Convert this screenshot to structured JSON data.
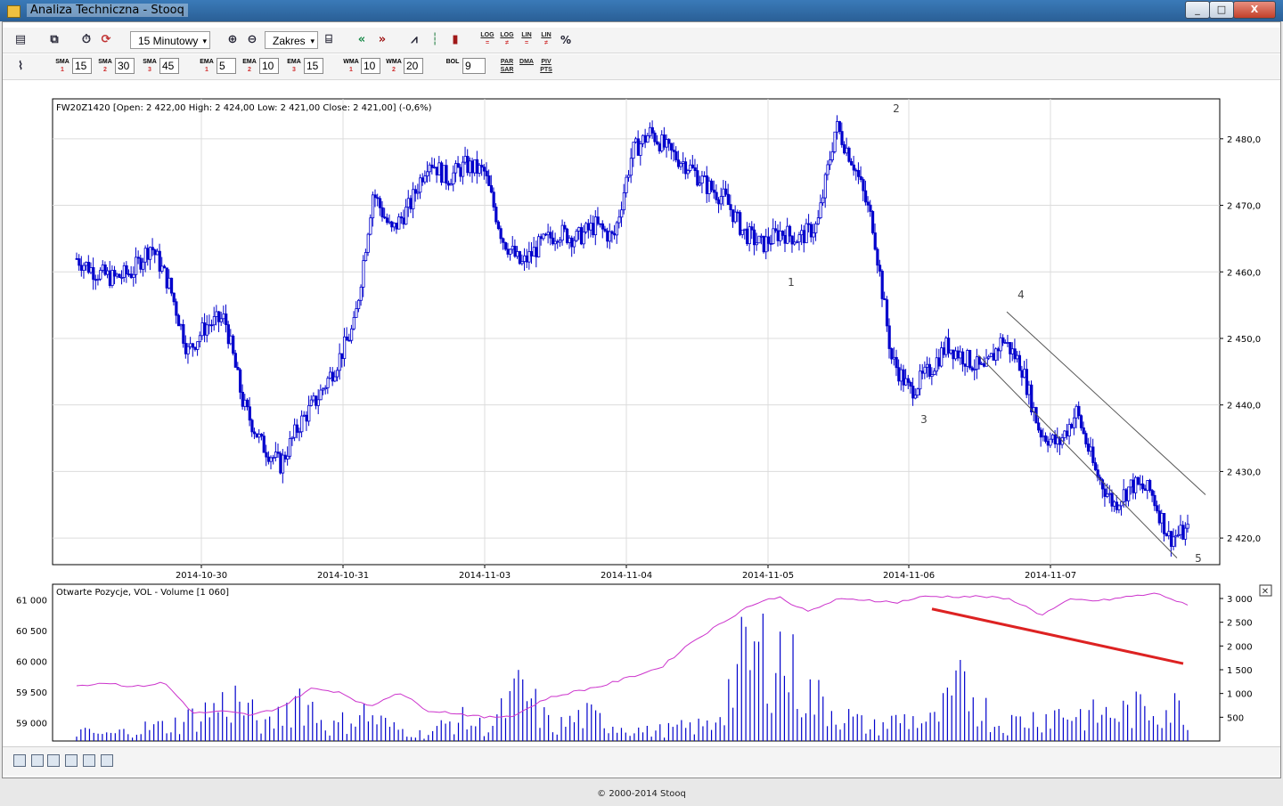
{
  "window": {
    "title": "Analiza Techniczna - Stooq",
    "minimize": "_",
    "maximize": "□",
    "close": "X"
  },
  "toolbar1": {
    "interval": "15 Minutowy",
    "range": "Zakres",
    "scales": [
      {
        "top": "LOG",
        "bottom": "="
      },
      {
        "top": "LOG",
        "bottom": "≠"
      },
      {
        "top": "LIN",
        "bottom": "="
      },
      {
        "top": "LIN",
        "bottom": "≠"
      }
    ],
    "percent": "%"
  },
  "toolbar2": {
    "indicators": [
      {
        "name": "SMA",
        "num": "1",
        "value": "15"
      },
      {
        "name": "SMA",
        "num": "2",
        "value": "30"
      },
      {
        "name": "SMA",
        "num": "3",
        "value": "45"
      },
      {
        "name": "EMA",
        "num": "1",
        "value": "5"
      },
      {
        "name": "EMA",
        "num": "2",
        "value": "10"
      },
      {
        "name": "EMA",
        "num": "3",
        "value": "15"
      },
      {
        "name": "WMA",
        "num": "1",
        "value": "10"
      },
      {
        "name": "WMA",
        "num": "2",
        "value": "20"
      },
      {
        "name": "BOL",
        "num": "",
        "value": "9"
      }
    ],
    "extra": [
      {
        "top": "PAR",
        "bottom": "SAR"
      },
      {
        "top": "DMA",
        "bottom": ""
      },
      {
        "top": "PIV",
        "bottom": "PTS"
      }
    ]
  },
  "price_panel": {
    "header": "FW20Z1420 [Open: 2 422,00  High: 2 424,00  Low: 2 421,00  Close: 2 421,00] (-0,6%)",
    "y_ticks": [
      "2 480,0",
      "2 470,0",
      "2 460,0",
      "2 450,0",
      "2 440,0",
      "2 430,0",
      "2 420,0"
    ],
    "x_ticks": [
      "2014-10-30",
      "2014-10-31",
      "2014-11-03",
      "2014-11-04",
      "2014-11-05",
      "2014-11-06",
      "2014-11-07"
    ],
    "wave_labels": [
      "2",
      "1",
      "4",
      "3",
      "5"
    ]
  },
  "volume_panel": {
    "header": "Otwarte Pozycje, VOL - Volume [1 060]",
    "left_ticks": [
      "61 000",
      "60 500",
      "60 000",
      "59 500",
      "59 000"
    ],
    "right_ticks": [
      "3 000",
      "2 500",
      "2 000",
      "1 500",
      "1 000",
      "500"
    ],
    "close": "✕"
  },
  "footer": {
    "copyright": "© 2000-2014 Stooq"
  },
  "colors": {
    "candle": "#0000cc",
    "open_interest": "#cc33cc",
    "trend": "#dd2222",
    "channel": "#444444"
  },
  "chart_data": [
    {
      "type": "candlestick",
      "instrument": "FW20Z1420",
      "interval": "15 min",
      "title": "FW20Z1420 [Open: 2 422,00  High: 2 424,00  Low: 2 421,00  Close: 2 421,00] (-0,6%)",
      "x": [
        "2014-10-30",
        "2014-10-31",
        "2014-11-03",
        "2014-11-04",
        "2014-11-05",
        "2014-11-06",
        "2014-11-07"
      ],
      "ylim": [
        2416,
        2486
      ],
      "approx_path": [
        {
          "t": "2014-10-29",
          "price": 2462
        },
        {
          "t": "2014-10-29",
          "price": 2460
        },
        {
          "t": "2014-10-29",
          "price": 2459
        },
        {
          "t": "2014-10-29",
          "price": 2460
        },
        {
          "t": "2014-10-29",
          "price": 2464
        },
        {
          "t": "2014-10-30",
          "price": 2458
        },
        {
          "t": "2014-10-30",
          "price": 2448
        },
        {
          "t": "2014-10-30",
          "price": 2452
        },
        {
          "t": "2014-10-30",
          "price": 2453
        },
        {
          "t": "2014-10-30",
          "price": 2440
        },
        {
          "t": "2014-10-30",
          "price": 2434
        },
        {
          "t": "2014-10-30",
          "price": 2431
        },
        {
          "t": "2014-10-30",
          "price": 2437
        },
        {
          "t": "2014-10-30",
          "price": 2441
        },
        {
          "t": "2014-10-30",
          "price": 2446
        },
        {
          "t": "2014-10-30",
          "price": 2452
        },
        {
          "t": "2014-10-31",
          "price": 2472
        },
        {
          "t": "2014-10-31",
          "price": 2466
        },
        {
          "t": "2014-10-31",
          "price": 2470
        },
        {
          "t": "2014-10-31",
          "price": 2477
        },
        {
          "t": "2014-10-31",
          "price": 2474
        },
        {
          "t": "2014-10-31",
          "price": 2476
        },
        {
          "t": "2014-10-31",
          "price": 2475
        },
        {
          "t": "2014-11-03",
          "price": 2465
        },
        {
          "t": "2014-11-03",
          "price": 2461
        },
        {
          "t": "2014-11-03",
          "price": 2464
        },
        {
          "t": "2014-11-03",
          "price": 2466
        },
        {
          "t": "2014-11-03",
          "price": 2465
        },
        {
          "t": "2014-11-03",
          "price": 2467
        },
        {
          "t": "2014-11-03",
          "price": 2465
        },
        {
          "t": "2014-11-04",
          "price": 2478
        },
        {
          "t": "2014-11-04",
          "price": 2481
        },
        {
          "t": "2014-11-04",
          "price": 2478
        },
        {
          "t": "2014-11-04",
          "price": 2476
        },
        {
          "t": "2014-11-04",
          "price": 2473
        },
        {
          "t": "2014-11-04",
          "price": 2471
        },
        {
          "t": "2014-11-05",
          "price": 2466
        },
        {
          "t": "2014-11-05",
          "price": 2464
        },
        {
          "t": "2014-11-05",
          "price": 2466
        },
        {
          "t": "2014-11-05",
          "price": 2465
        },
        {
          "t": "2014-11-05",
          "price": 2467
        },
        {
          "t": "2014-11-05",
          "price": 2482
        },
        {
          "t": "2014-11-05",
          "price": 2476
        },
        {
          "t": "2014-11-05",
          "price": 2467
        },
        {
          "t": "2014-11-06",
          "price": 2447
        },
        {
          "t": "2014-11-06",
          "price": 2442
        },
        {
          "t": "2014-11-06",
          "price": 2445
        },
        {
          "t": "2014-11-06",
          "price": 2449
        },
        {
          "t": "2014-11-06",
          "price": 2447
        },
        {
          "t": "2014-11-06",
          "price": 2445
        },
        {
          "t": "2014-11-06",
          "price": 2450
        },
        {
          "t": "2014-11-06",
          "price": 2446
        },
        {
          "t": "2014-11-07",
          "price": 2436
        },
        {
          "t": "2014-11-07",
          "price": 2434
        },
        {
          "t": "2014-11-07",
          "price": 2439
        },
        {
          "t": "2014-11-07",
          "price": 2430
        },
        {
          "t": "2014-11-07",
          "price": 2425
        },
        {
          "t": "2014-11-07",
          "price": 2428
        },
        {
          "t": "2014-11-07",
          "price": 2427
        },
        {
          "t": "2014-11-07",
          "price": 2420
        },
        {
          "t": "2014-11-07",
          "price": 2421
        }
      ],
      "wave_labels": [
        "2",
        "1",
        "4",
        "3",
        "5"
      ],
      "annotations": [
        "descending channel"
      ]
    },
    {
      "type": "bar+line",
      "title": "Otwarte Pozycje, VOL - Volume [1 060]",
      "series": [
        {
          "name": "Otwarte Pozycje",
          "axis": "left",
          "approx_values": [
            59600,
            59650,
            59580,
            59650,
            59150,
            59180,
            59120,
            59250,
            59550,
            59500,
            59250,
            59500,
            59200,
            59150,
            59080,
            59120,
            59380,
            59500,
            59600,
            59750,
            59900,
            60300,
            60600,
            60900,
            61050,
            60800,
            61000,
            61000,
            60950,
            61050,
            61050,
            61050,
            61000,
            60750,
            61000,
            60980,
            61050,
            61100,
            60900
          ]
        },
        {
          "name": "VOL - Volume",
          "axis": "right",
          "approx_values": [
            300,
            200,
            400,
            500,
            900,
            1300,
            400,
            1500,
            400,
            900,
            400,
            200,
            700,
            400,
            1600,
            400,
            800,
            500,
            300,
            400,
            500,
            2500,
            3000,
            1500,
            900,
            400,
            700,
            600,
            1800,
            500,
            700,
            900,
            800,
            900,
            1100,
            1000
          ]
        }
      ],
      "left_range": [
        58700,
        61250
      ],
      "right_range": [
        0,
        3300
      ],
      "trendline": "descending (red)"
    }
  ]
}
